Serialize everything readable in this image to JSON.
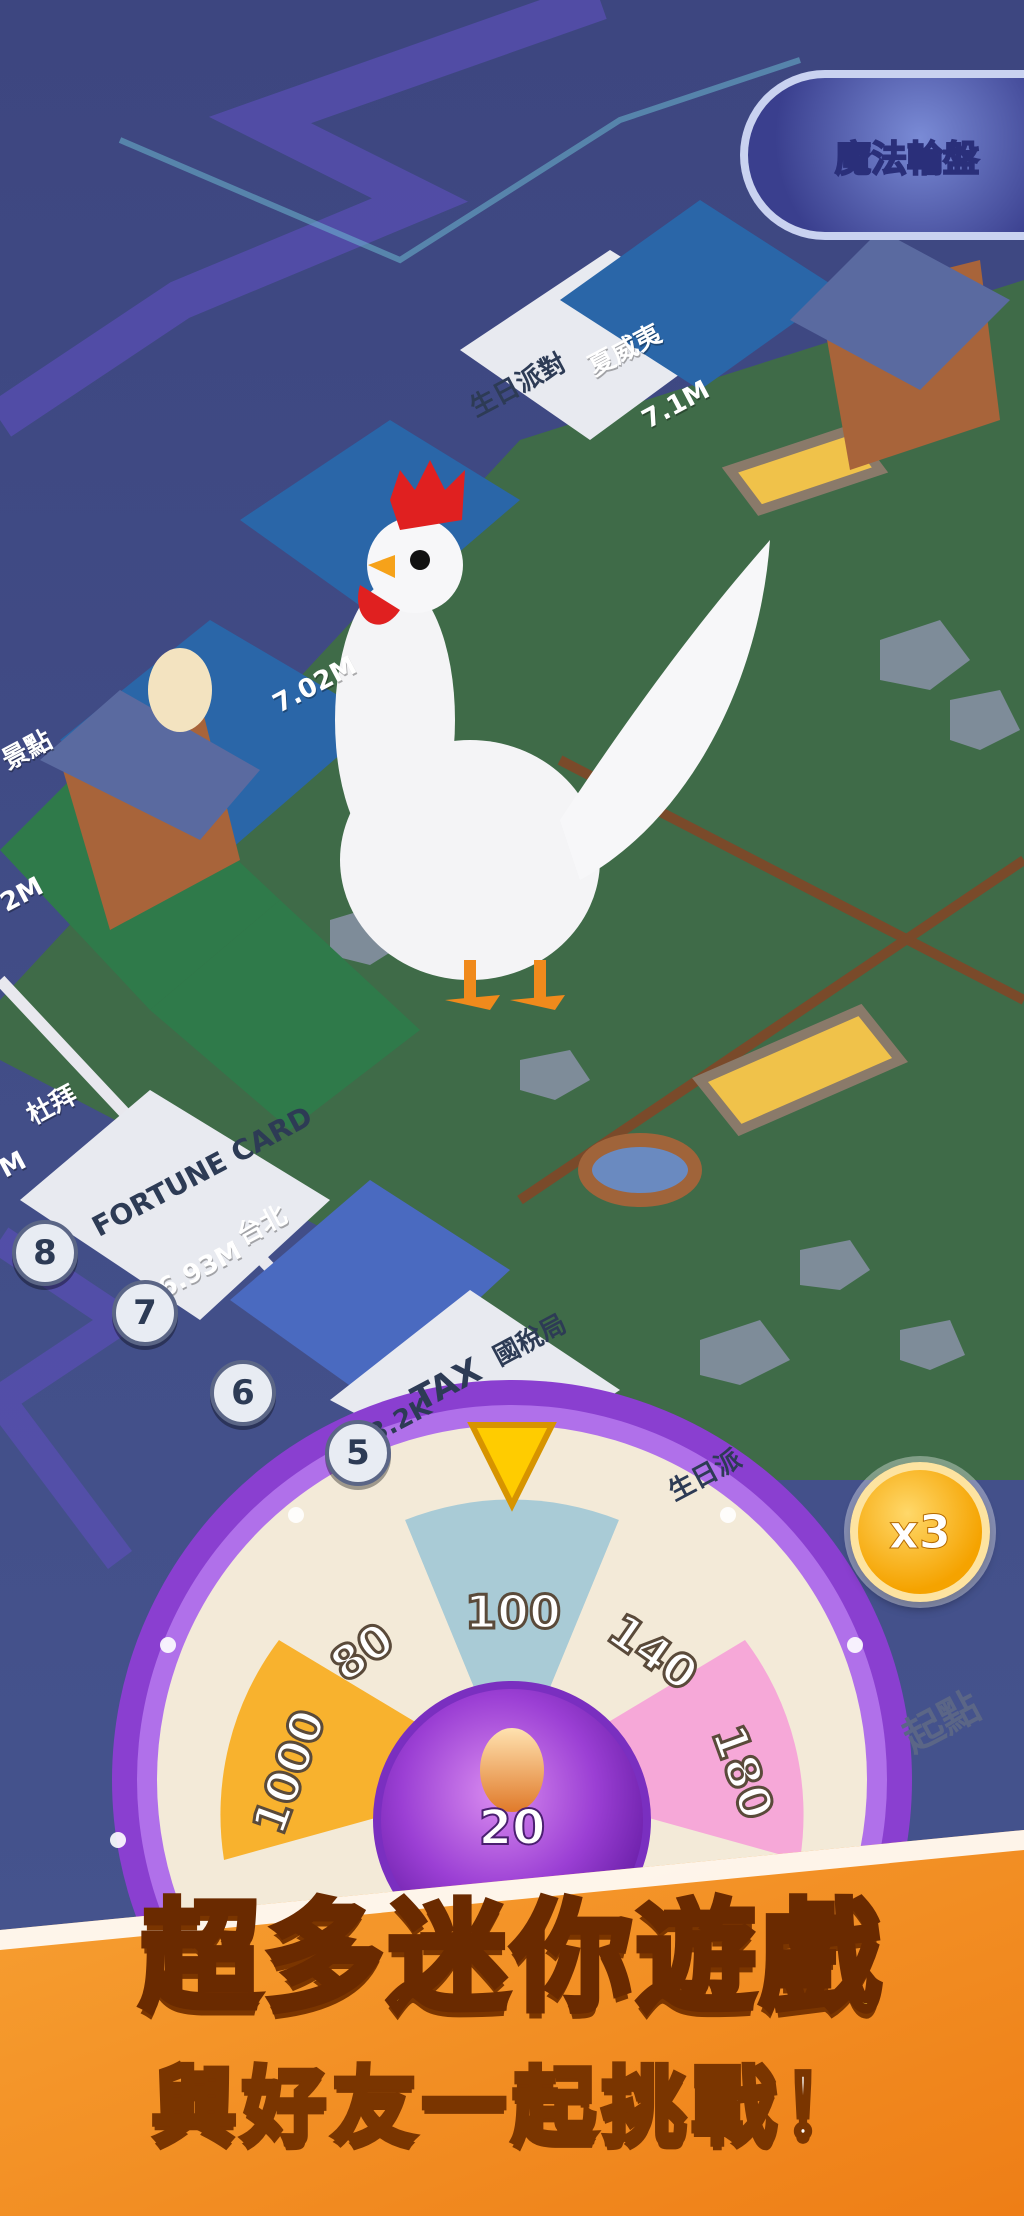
{
  "badge": {
    "title": "魔法輪盤"
  },
  "board": {
    "tiles": {
      "birthday_party": "生日派對",
      "hawaii": "夏威夷",
      "hawaii_price": "7.1M",
      "left_city_price": "7.02M",
      "dubai": "杜拜",
      "taipei": "台北",
      "taipei_price": "6.93M",
      "fortune_card": "FORTUNE CARD",
      "tax_office": "國稅局",
      "tax": "TAX",
      "tax_amount": "23.2K",
      "birthday_party_short": "生日派",
      "start": "起點",
      "scenic": "景點",
      "price_left_1": "M",
      "price_left_2": "2M"
    },
    "step_numbers": [
      "8",
      "7",
      "6",
      "5"
    ]
  },
  "multiplier": {
    "label": "x3"
  },
  "wheel": {
    "segments": [
      {
        "label": "100",
        "color": "#a9cbd6"
      },
      {
        "label": "140",
        "color": "#f3ead8"
      },
      {
        "label": "180",
        "color": "#f6a8d8"
      },
      {
        "label": "1000",
        "color": "#f8b22e"
      },
      {
        "label": "80",
        "color": "#f3ead8"
      }
    ],
    "center_value": "20"
  },
  "banner": {
    "headline": "超多迷你遊戲",
    "subline": "與好友一起挑戰！"
  },
  "colors": {
    "banner_orange": "#f08a1c",
    "wheel_rim": "#8a3fd0",
    "grass": "#3f6b48",
    "pointer_yellow": "#ffcc00"
  }
}
